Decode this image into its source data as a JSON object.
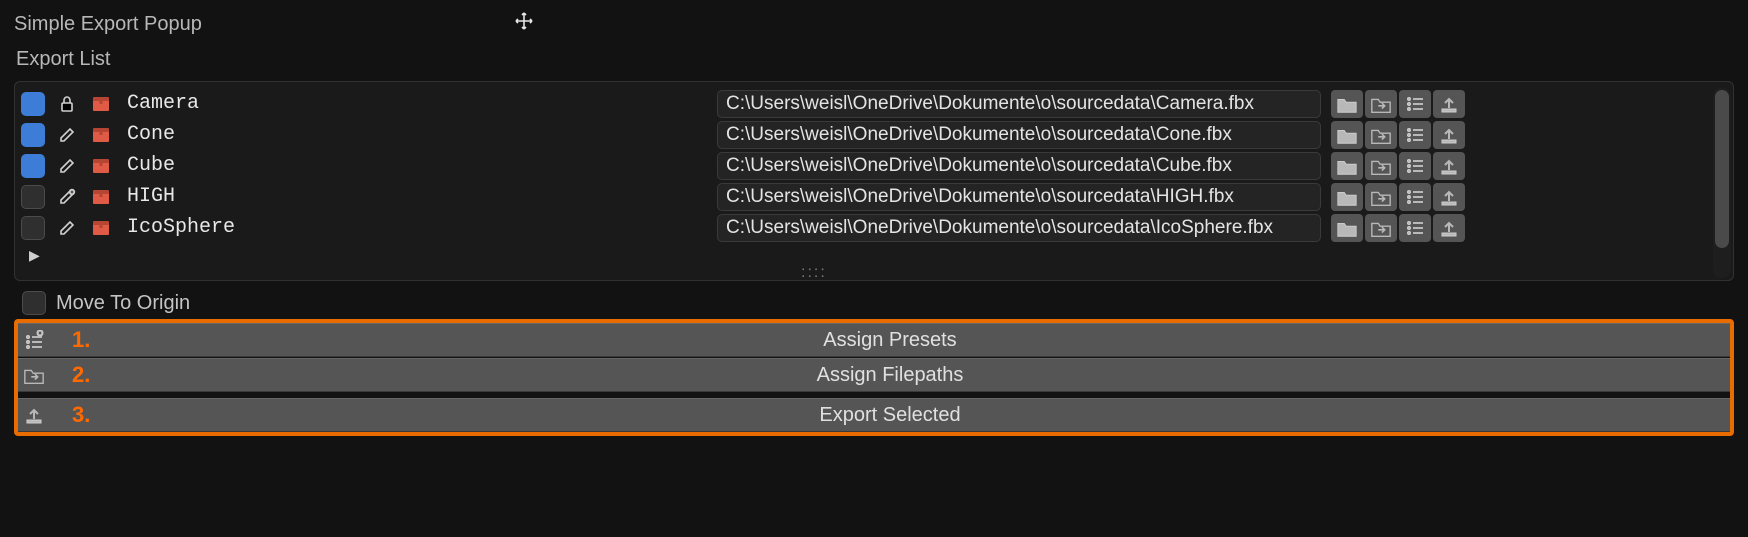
{
  "header": {
    "title": "Simple Export Popup",
    "sub": "Export List"
  },
  "rows": {
    "r0": {
      "name": "Camera",
      "path": "C:\\Users\\weisl\\OneDrive\\Dokumente\\o\\sourcedata\\Camera.fbx"
    },
    "r1": {
      "name": "Cone",
      "path": "C:\\Users\\weisl\\OneDrive\\Dokumente\\o\\sourcedata\\Cone.fbx"
    },
    "r2": {
      "name": "Cube",
      "path": "C:\\Users\\weisl\\OneDrive\\Dokumente\\o\\sourcedata\\Cube.fbx"
    },
    "r3": {
      "name": "HIGH",
      "path": "C:\\Users\\weisl\\OneDrive\\Dokumente\\o\\sourcedata\\HIGH.fbx"
    },
    "r4": {
      "name": "IcoSphere",
      "path": "C:\\Users\\weisl\\OneDrive\\Dokumente\\o\\sourcedata\\IcoSphere.fbx"
    }
  },
  "move_origin": "Move To Origin",
  "buttons": {
    "assign_presets": {
      "num": "1.",
      "label": "Assign Presets"
    },
    "assign_filepaths": {
      "num": "2.",
      "label": "Assign Filepaths"
    },
    "export_selected": {
      "num": "3.",
      "label": "Export Selected"
    }
  },
  "resize_dots": "::::"
}
